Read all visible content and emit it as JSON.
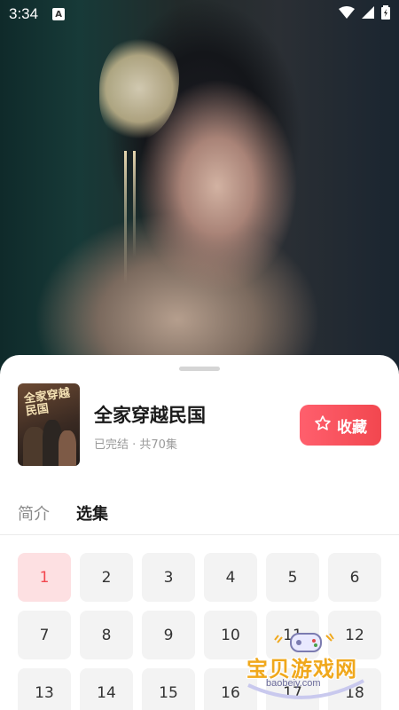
{
  "status_bar": {
    "time": "3:34",
    "notification_badge": "A",
    "icons": [
      "wifi-icon",
      "signal-icon",
      "battery-charging-icon"
    ]
  },
  "drama": {
    "title": "全家穿越民国",
    "meta": "已完结 · 共70集",
    "cover_text": "全家穿越民国"
  },
  "actions": {
    "favorite_label": "收藏",
    "favorite_icon": "star-outline-icon"
  },
  "tabs": [
    {
      "label": "简介",
      "active": false
    },
    {
      "label": "选集",
      "active": true
    }
  ],
  "episodes": {
    "selected": "1",
    "visible": [
      "1",
      "2",
      "3",
      "4",
      "5",
      "6",
      "7",
      "8",
      "9",
      "10",
      "11",
      "12",
      "13",
      "14",
      "15",
      "16",
      "17",
      "18"
    ]
  },
  "watermark": {
    "text": "宝贝游戏网",
    "url": "baobeiy.com"
  },
  "colors": {
    "accent": "#f2474f",
    "selected_bg": "#fde0e2",
    "episode_bg": "#f3f3f3"
  }
}
